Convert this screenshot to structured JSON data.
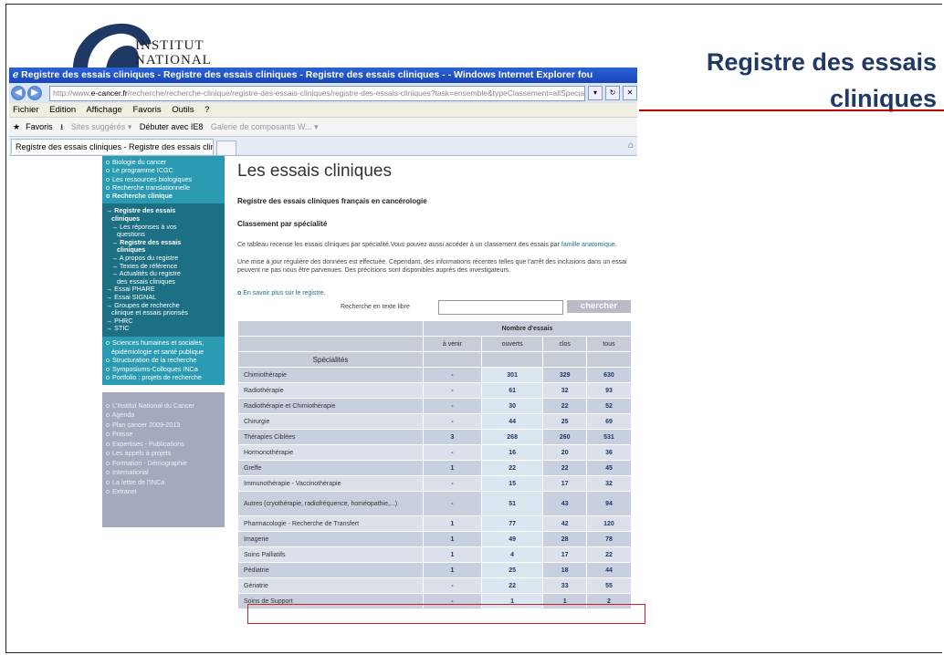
{
  "logo": {
    "line1": "INSTITUT",
    "line2": "NATIONAL"
  },
  "slide": {
    "title": "Registre des essais cliniques"
  },
  "browser": {
    "window_title": "Registre des essais cliniques - Registre des essais cliniques - Registre des essais cliniques - - Windows Internet Explorer fou",
    "address_prefix": "http://www.",
    "address_domain": "e-cancer.fr",
    "address_rest": "/recherche/recherche-clinique/registre-des-essais-cliniques/registre-des-essais-cliniques?task=ensemble&typeClassement=allSpecialite",
    "menu": [
      "Fichier",
      "Edition",
      "Affichage",
      "Favoris",
      "Outils",
      "?"
    ],
    "favorites": {
      "label": "Favoris",
      "suggested": "Sites suggérés ▾",
      "ie8": "Débuter avec IE8",
      "gallery": "Galerie de composants W... ▾"
    },
    "tab_title": "Registre des essais cliniques - Registre des essais clini..."
  },
  "sidebar": {
    "block1": [
      "Biologie du cancer",
      "Le programme ICGC",
      "Les ressources biologiques",
      "Recherche translationnelle",
      "Recherche clinique"
    ],
    "active": [
      "→ Registre des essais",
      "   cliniques",
      "   → Les réponses à vos",
      "      questions",
      "   → Registre des essais",
      "      cliniques",
      "   → A propos du registre",
      "   → Textes de référence",
      "   → Actualités du registre",
      "      des essais cliniques",
      "→ Essai PHARE",
      "→ Essai SIGNAL",
      "→ Groupes de recherche",
      "   clinique et essais priorisés",
      "→ PHRC",
      "→ STIC"
    ],
    "block2": [
      "Sciences humaines et sociales,",
      "épidémiologie et santé publique",
      "Structuration de la recherche",
      "Symposiums-Colloques INCa",
      "Portfolio : projets de recherche"
    ],
    "block3": [
      "L'Institut National du Cancer",
      "Agenda",
      "Plan cancer 2009-2013",
      "Presse",
      "Expertises - Publications",
      "Les appels à projets",
      "Formation - Démographie",
      "International",
      "La lettre de l'INCa",
      "Extranet"
    ]
  },
  "content": {
    "heading": "Les essais cliniques",
    "subtitle": "Registre des essais cliniques français en cancérologie",
    "classement": "Classement par spécialité",
    "para1_text": "Ce tableau recense les essais cliniques par spécialité.Vous pouvez aussi accéder à un classement des essais par ",
    "para1_link": "famille anatomique",
    "para2": "Une mise à jour régulière des données est effectuée. Cependant, des informations récentes telles que l'arrêt des inclusions dans un essai peuvent ne pas nous être parvenues. Des précisions sont disponibles auprès des investigateurs.",
    "more_link": "En savoir plus sur le registre.",
    "search_label": "Recherche en texte libre",
    "search_button": "chercher"
  },
  "table": {
    "group_header": "Nombre d'essais",
    "columns": [
      "à venir",
      "ouverts",
      "clos",
      "tous"
    ],
    "spec_header": "Spécialités",
    "rows": [
      {
        "name": "Chimiothérapie",
        "a_venir": "-",
        "ouverts": "301",
        "clos": "329",
        "tous": "630"
      },
      {
        "name": "Radiothérapie",
        "a_venir": "-",
        "ouverts": "61",
        "clos": "32",
        "tous": "93"
      },
      {
        "name": "Radiothérapie et Chimiothérapie",
        "a_venir": "-",
        "ouverts": "30",
        "clos": "22",
        "tous": "52"
      },
      {
        "name": "Chirurgie",
        "a_venir": "-",
        "ouverts": "44",
        "clos": "25",
        "tous": "69"
      },
      {
        "name": "Thérapies Ciblées",
        "a_venir": "3",
        "ouverts": "268",
        "clos": "260",
        "tous": "531"
      },
      {
        "name": "Hormonothérapie",
        "a_venir": "-",
        "ouverts": "16",
        "clos": "20",
        "tous": "36"
      },
      {
        "name": "Greffe",
        "a_venir": "1",
        "ouverts": "22",
        "clos": "22",
        "tous": "45"
      },
      {
        "name": "Immunothérapie - Vaccinothérapie",
        "a_venir": "-",
        "ouverts": "15",
        "clos": "17",
        "tous": "32"
      },
      {
        "name": "Autres (cryothérapie, radiofréquence, homéopathie,...)",
        "a_venir": "-",
        "ouverts": "51",
        "clos": "43",
        "tous": "94"
      },
      {
        "name": "Pharmacologie - Recherche de Transfert",
        "a_venir": "1",
        "ouverts": "77",
        "clos": "42",
        "tous": "120"
      },
      {
        "name": "Imagerie",
        "a_venir": "1",
        "ouverts": "49",
        "clos": "28",
        "tous": "78"
      },
      {
        "name": "Soins Palliatifs",
        "a_venir": "1",
        "ouverts": "4",
        "clos": "17",
        "tous": "22"
      },
      {
        "name": "Pédiatrie",
        "a_venir": "1",
        "ouverts": "25",
        "clos": "18",
        "tous": "44"
      },
      {
        "name": "Gériatrie",
        "a_venir": "-",
        "ouverts": "22",
        "clos": "33",
        "tous": "55"
      },
      {
        "name": "Soins de Support",
        "a_venir": "-",
        "ouverts": "1",
        "clos": "1",
        "tous": "2"
      }
    ]
  },
  "colors": {
    "accent": "#1f3864",
    "highlight": "#d21f1f",
    "sidebar": "#2b9bb3",
    "sidebar_active": "#1d6f84"
  }
}
